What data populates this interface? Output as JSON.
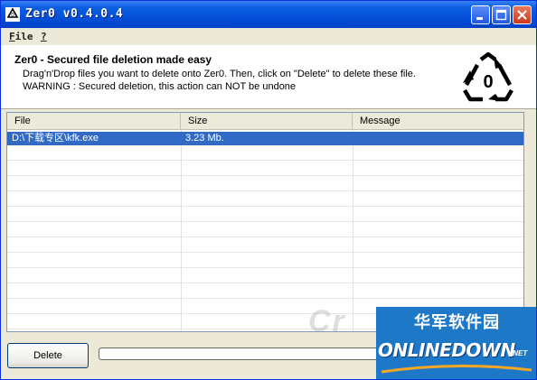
{
  "window": {
    "title": "Zer0 v0.4.0.4",
    "colors": {
      "titlebar": "#0550DA",
      "close": "#C8391A",
      "selection": "#316AC5"
    }
  },
  "menu": {
    "file": {
      "accel": "F",
      "rest": "ile"
    },
    "help": {
      "accel": "?"
    }
  },
  "header": {
    "title": "Zer0 - Secured file deletion made easy",
    "line1": "Drag'n'Drop files you want to delete onto Zer0. Then, click on \"Delete\" to delete these file.",
    "line2": "WARNING : Secured deletion, this action can NOT be undone",
    "logo_icon": "recycle-zero-icon",
    "logo_text": "0"
  },
  "file_list": {
    "columns": [
      "File",
      "Size",
      "Message"
    ],
    "rows": [
      {
        "file": "D:\\下载专区\\kfk.exe",
        "size": "3.23 Mb.",
        "message": "",
        "selected": true
      }
    ]
  },
  "watermark": "Cr",
  "actions": {
    "delete_label": "Delete"
  },
  "progress": {
    "value": 0
  },
  "overlay_badge": {
    "cn": "华军软件园",
    "en": "ONLINEDOWN",
    "suffix": ".NET"
  }
}
